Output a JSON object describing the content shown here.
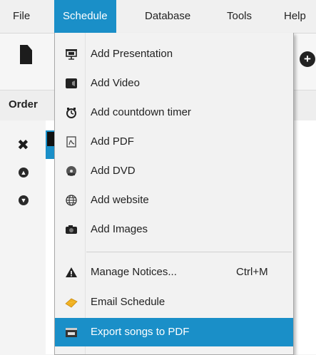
{
  "menubar": {
    "file": "File",
    "schedule": "Schedule",
    "database": "Database",
    "tools": "Tools",
    "help": "Help"
  },
  "panel": {
    "order_label": "Order"
  },
  "menu": {
    "items": [
      {
        "label": "Add Presentation",
        "icon": "presentation-icon"
      },
      {
        "label": "Add Video",
        "icon": "video-icon"
      },
      {
        "label": "Add countdown timer",
        "icon": "timer-icon"
      },
      {
        "label": "Add PDF",
        "icon": "pdf-icon"
      },
      {
        "label": "Add DVD",
        "icon": "dvd-icon"
      },
      {
        "label": "Add website",
        "icon": "globe-icon"
      },
      {
        "label": "Add Images",
        "icon": "camera-icon"
      },
      {
        "label": "Manage Notices...",
        "shortcut": "Ctrl+M",
        "icon": "warning-icon"
      },
      {
        "label": "Email Schedule",
        "icon": "email-icon"
      },
      {
        "label": "Export songs to PDF",
        "icon": "export-pdf-icon",
        "highlighted": true
      }
    ]
  },
  "colors": {
    "accent": "#1a8fc8",
    "menu_bg": "#f2f2f2"
  }
}
